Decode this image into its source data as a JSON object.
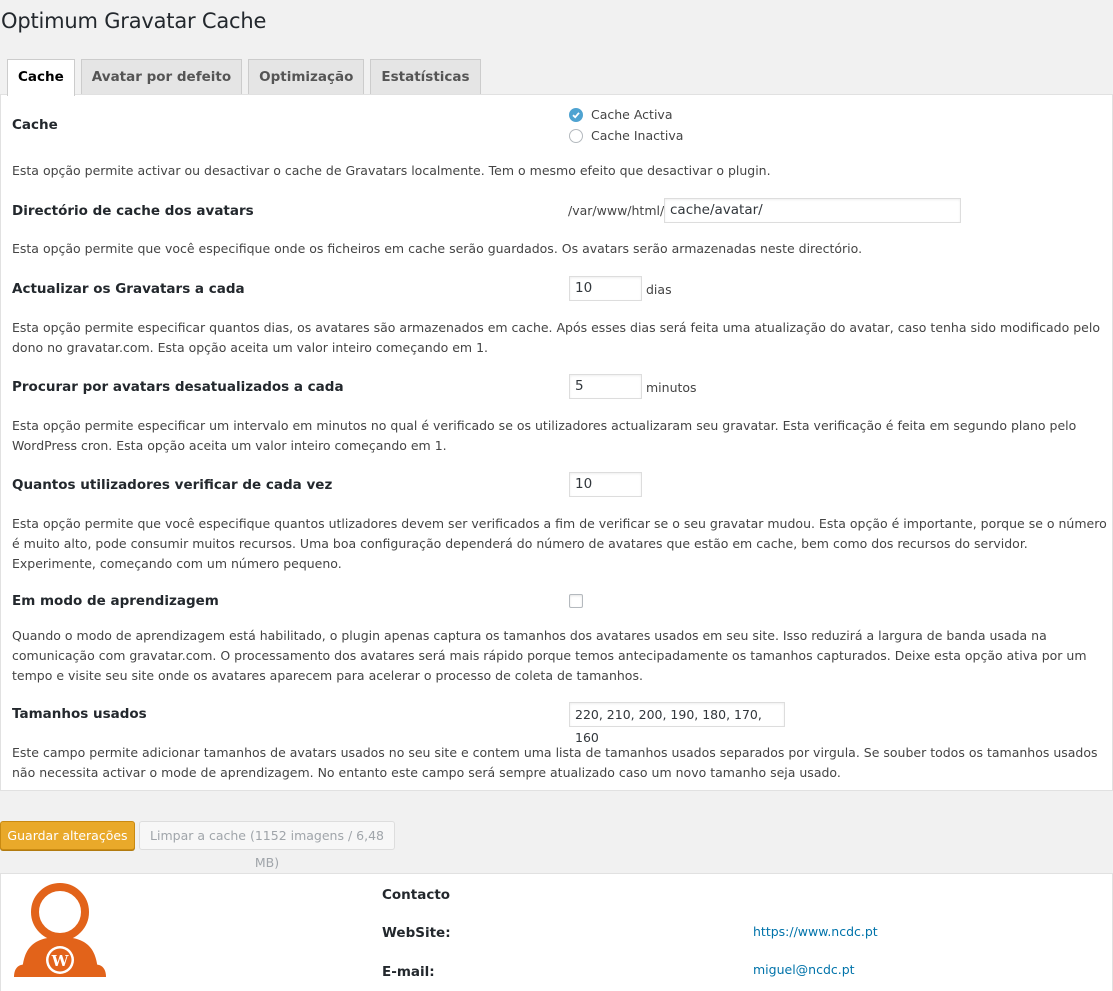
{
  "title": "Optimum Gravatar Cache",
  "tabs": [
    {
      "label": "Cache"
    },
    {
      "label": "Avatar por defeito"
    },
    {
      "label": "Optimização"
    },
    {
      "label": "Estatísticas"
    }
  ],
  "cache": {
    "label": "Cache",
    "option_active": "Cache Activa",
    "option_inactive": "Cache Inactiva",
    "selected": "active",
    "desc": "Esta opção permite activar ou desactivar o cache de Gravatars localmente. Tem o mesmo efeito que desactivar o plugin."
  },
  "directory": {
    "label": "Directório de cache dos avatars",
    "prefix": "/var/www/html/",
    "value": "cache/avatar/",
    "desc": "Esta opção permite que você especifique onde os ficheiros em cache serão guardados. Os avatars serão armazenadas neste directório."
  },
  "update": {
    "label": "Actualizar os Gravatars a cada",
    "value": "10",
    "unit": "dias",
    "desc": "Esta opção permite especificar quantos dias, os avatares são armazenados em cache. Após esses dias será feita uma atualização do avatar, caso tenha sido modificado pelo dono no gravatar.com. Esta opção aceita um valor inteiro começando em 1."
  },
  "check": {
    "label": "Procurar por avatars desatualizados a cada",
    "value": "5",
    "unit": "minutos",
    "desc": "Esta opção permite especificar um intervalo em minutos no qual é verificado se os utilizadores actualizaram seu gravatar. Esta verificação é feita em segundo plano pelo WordPress cron. Esta opção aceita um valor inteiro começando em 1."
  },
  "users": {
    "label": "Quantos utilizadores verificar de cada vez",
    "value": "10",
    "desc": "Esta opção permite que você especifique quantos utlizadores devem ser verificados a fim de verificar se o seu gravatar mudou. Esta opção é importante, porque se o número é muito alto, pode consumir muitos recursos. Uma boa configuração dependerá do número de avatares que estão em cache, bem como dos recursos do servidor. Experimente, começando com um número pequeno."
  },
  "learning": {
    "label": "Em modo de aprendizagem",
    "checked": false,
    "desc": "Quando o modo de aprendizagem está habilitado, o plugin apenas captura os tamanhos dos avatares usados em seu site. Isso reduzirá a largura de banda usada na comunicação com gravatar.com. O processamento dos avatares será mais rápido porque temos antecipadamente os tamanhos capturados. Deixe esta opção ativa por um tempo e visite seu site onde os avatares aparecem para acelerar o processo de coleta de tamanhos."
  },
  "sizes": {
    "label": "Tamanhos usados",
    "value": "220, 210, 200, 190, 180, 170, 160",
    "desc": "Este campo permite adicionar tamanhos de avatars usados no seu site e contem uma lista de tamanhos usados separados por virgula. Se souber todos os tamanhos usados não necessita activar o mode de aprendizagem. No entanto este campo será sempre atualizado caso um novo tamanho seja usado."
  },
  "buttons": {
    "save": "Guardar alterações",
    "clear": "Limpar a cache (1152 imagens / 6,48 MB)"
  },
  "footer": {
    "contact_label": "Contacto",
    "website_label": "WebSite:",
    "website_url": "https://www.ncdc.pt",
    "email_label": "E-mail:",
    "email": "miguel@ncdc.pt"
  },
  "colors": {
    "primary_button": "#e9a92a",
    "logo": "#e2631a",
    "link": "#0073aa",
    "radio_checked": "#4fa3d1"
  }
}
